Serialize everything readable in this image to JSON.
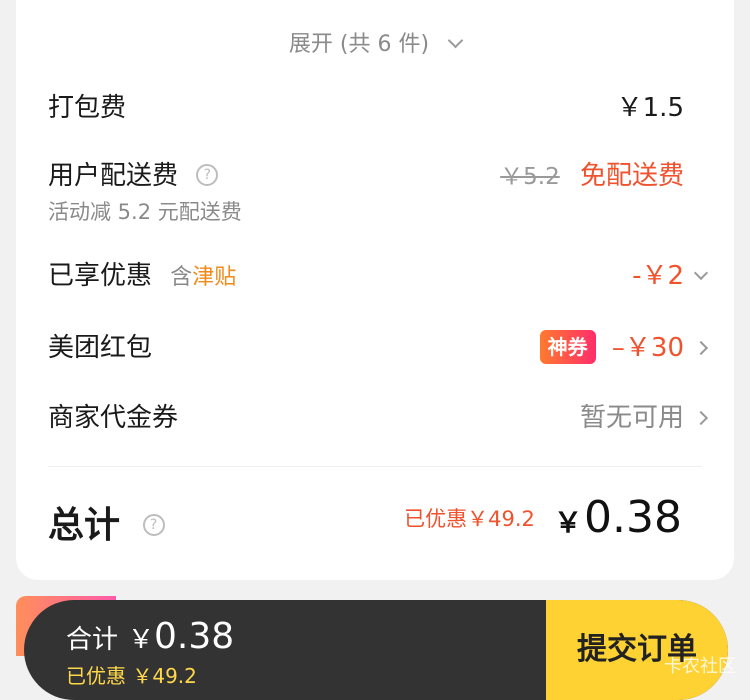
{
  "expand": {
    "label": "展开 (共 6 件)"
  },
  "packing_fee": {
    "label": "打包费",
    "value": "￥1.5"
  },
  "delivery_fee": {
    "label": "用户配送费",
    "original": "￥5.2",
    "value": "免配送费",
    "note": "活动减 5.2 元配送费"
  },
  "discount": {
    "label": "已享优惠",
    "prefix": "含",
    "tag": "津贴",
    "value": "-￥2"
  },
  "red_packet": {
    "label": "美团红包",
    "badge": "神券",
    "value": "–￥30"
  },
  "voucher": {
    "label": "商家代金券",
    "value": "暂无可用"
  },
  "total": {
    "label": "总计",
    "saved": "已优惠￥49.2",
    "currency": "￥",
    "amount": "0.38"
  },
  "bottom_bar": {
    "total_label": "合计",
    "currency": "￥",
    "amount": "0.38",
    "saved": "已优惠 ￥49.2",
    "submit_label": "提交订单"
  },
  "watermark": "卡农社区",
  "colors": {
    "accent_red": "#f0522e",
    "accent_orange": "#f08a1a",
    "submit_yellow": "#ffd233",
    "bar_dark": "#333333"
  }
}
